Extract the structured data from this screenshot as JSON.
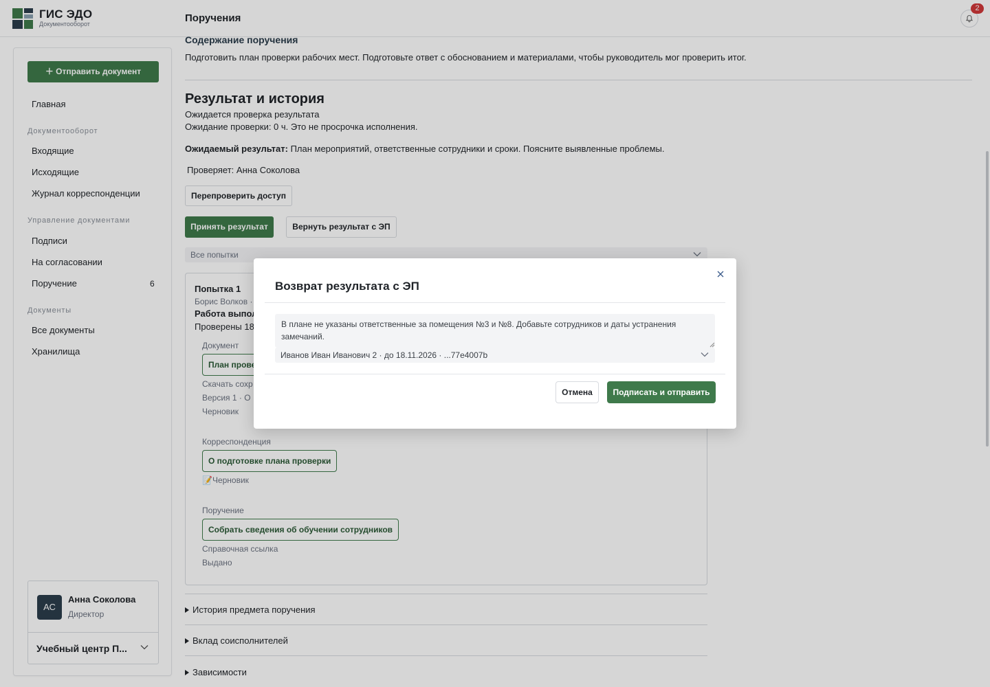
{
  "brand": {
    "title": "ГИС ЭДО",
    "subtitle": "Документооборот"
  },
  "header": {
    "page_title": "Поручения",
    "notifications_count": "2"
  },
  "sidebar": {
    "send_button": "＋ Отправить документ",
    "home": "Главная",
    "sections": [
      {
        "title": "Документооборот",
        "items": [
          "Входящие",
          "Исходящие",
          "Журнал корреспонденции"
        ]
      },
      {
        "title": "Управление документами",
        "items": [
          "Подписи",
          "На согласовании",
          "Поручение"
        ]
      },
      {
        "title": "Документы",
        "items": [
          "Все документы",
          "Хранилища"
        ]
      }
    ],
    "assignment_count": "6",
    "user": {
      "initials": "АС",
      "name": "Анна Соколова",
      "role": "Директор",
      "org": "Учебный центр П..."
    }
  },
  "main": {
    "content_heading": "Содержание поручения",
    "content_text": "Подготовить план проверки рабочих мест. Подготовьте ответ с обоснованием и материалами, чтобы руководитель мог проверить итог.",
    "result_heading": "Результат и история",
    "status_line": "Ожидается проверка результата",
    "waiting_line": "Ожидание проверки: 0 ч. Это не просрочка исполнения.",
    "expected_label": "Ожидаемый результат:",
    "expected_text": " План мероприятий, ответственные сотрудники и сроки. Поясните выявленные проблемы.",
    "reviewer": "Проверяет: Анна Соколова",
    "recheck_button": "Перепроверить доступ",
    "accept_button": "Принять результат",
    "return_button": "Вернуть результат с ЭП",
    "attempts_select": "Все попытки",
    "attempt": {
      "title": "Попытка 1",
      "author": "Борис Волков ·",
      "work_line": "Работа выпол",
      "checked_line": "Проверены 18",
      "document_label": "Документ",
      "document_chip": "План прове",
      "download_line": "Скачать сохр",
      "version_line": "Версия 1 · О",
      "draft_line": "Черновик",
      "correspondence_label": "Корреспонденция",
      "correspondence_chip": "О подготовке плана проверки",
      "correspondence_status": "📝Черновик",
      "assignment_label": "Поручение",
      "assignment_chip": "Собрать сведения об обучении сотрудников",
      "assignment_ref": "Справочная ссылка",
      "assignment_status": "Выдано"
    },
    "collapsibles": [
      "История предмета поручения",
      "Вклад соисполнителей",
      "Зависимости"
    ]
  },
  "modal": {
    "title": "Возврат результата с ЭП",
    "comment": "В плане не указаны ответственные за помещения №3 и №8. Добавьте сотрудников и даты устранения замечаний.",
    "certificate": "Иванов Иван Иванович 2 · до 18.11.2026 · ...77e4007b",
    "cancel_button": "Отмена",
    "sign_button": "Подписать и отправить"
  },
  "colors": {
    "accent": "#3f7a4b",
    "badge": "#d0383a",
    "avatar": "#2b3d4c"
  }
}
